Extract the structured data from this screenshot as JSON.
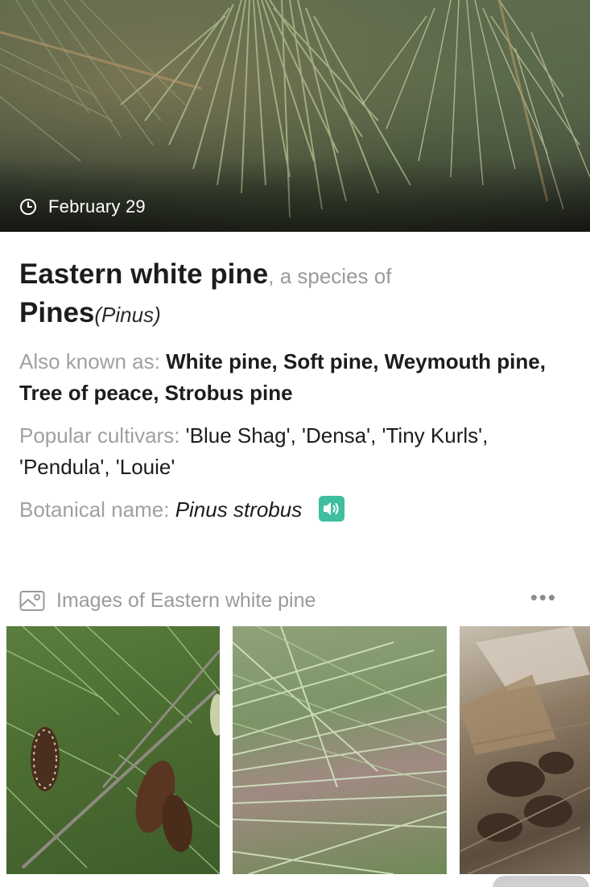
{
  "hero": {
    "image_alt": "Pine needles close-up",
    "date_icon": "clock-icon",
    "date": "February 29"
  },
  "plant": {
    "common_name": "Eastern white pine",
    "species_of_text": ", a species of",
    "genus_common": "Pines",
    "genus_latin": "(Pinus)",
    "also_known_label": "Also known as:",
    "also_known_value": "White pine, Soft pine, Weymouth pine, Tree of peace, Strobus pine",
    "cultivars_label": "Popular cultivars:",
    "cultivars_value": "'Blue Shag', 'Densa', 'Tiny Kurls', 'Pendula', 'Louie'",
    "botanical_label": "Botanical name:",
    "botanical_value": "Pinus strobus",
    "pronounce_icon": "speaker-icon"
  },
  "images": {
    "header_icon": "gallery-icon",
    "title": "Images of Eastern white pine",
    "more_icon": "more-icon",
    "more_glyph": "•••",
    "thumbnails": [
      {
        "alt": "Pine branch with cones"
      },
      {
        "alt": "Pine needles close-up"
      },
      {
        "alt": "Pine cones on ground"
      }
    ]
  },
  "colors": {
    "accent": "#3fbfa0",
    "label_gray": "#a0a0a0",
    "text_dark": "#1c1c1c"
  }
}
